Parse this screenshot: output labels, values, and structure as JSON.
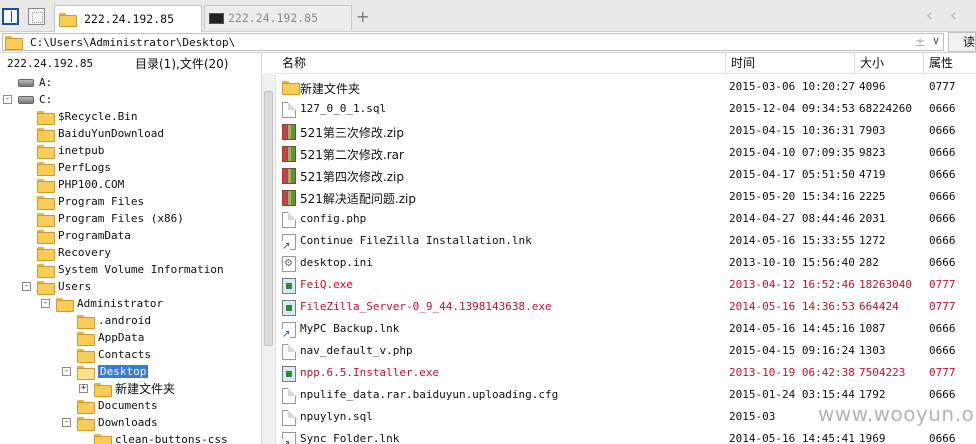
{
  "tabs": [
    {
      "label": "222.24.192.85",
      "active": true
    },
    {
      "label": "222.24.192.85",
      "active": false
    }
  ],
  "address": {
    "path": "C:\\Users\\Administrator\\Desktop\\",
    "read_label": "读"
  },
  "left": {
    "host": "222.24.192.85",
    "summary": "目录(1),文件(20)",
    "tree": [
      {
        "label": "A:",
        "depth": 0,
        "icon": "drive",
        "exp": ""
      },
      {
        "label": "C:",
        "depth": 0,
        "icon": "drive",
        "exp": "-"
      },
      {
        "label": "$Recycle.Bin",
        "depth": 1,
        "icon": "folder",
        "exp": ""
      },
      {
        "label": "BaiduYunDownload",
        "depth": 1,
        "icon": "folder",
        "exp": ""
      },
      {
        "label": "inetpub",
        "depth": 1,
        "icon": "folder",
        "exp": ""
      },
      {
        "label": "PerfLogs",
        "depth": 1,
        "icon": "folder",
        "exp": ""
      },
      {
        "label": "PHP100.COM",
        "depth": 1,
        "icon": "folder",
        "exp": ""
      },
      {
        "label": "Program Files",
        "depth": 1,
        "icon": "folder",
        "exp": ""
      },
      {
        "label": "Program Files (x86)",
        "depth": 1,
        "icon": "folder",
        "exp": ""
      },
      {
        "label": "ProgramData",
        "depth": 1,
        "icon": "folder",
        "exp": ""
      },
      {
        "label": "Recovery",
        "depth": 1,
        "icon": "folder",
        "exp": ""
      },
      {
        "label": "System Volume Information",
        "depth": 1,
        "icon": "folder",
        "exp": ""
      },
      {
        "label": "Users",
        "depth": 1,
        "icon": "folder",
        "exp": "-"
      },
      {
        "label": "Administrator",
        "depth": 2,
        "icon": "folder",
        "exp": "-"
      },
      {
        "label": ".android",
        "depth": 3,
        "icon": "folder",
        "exp": ""
      },
      {
        "label": "AppData",
        "depth": 3,
        "icon": "folder",
        "exp": ""
      },
      {
        "label": "Contacts",
        "depth": 3,
        "icon": "folder",
        "exp": ""
      },
      {
        "label": "Desktop",
        "depth": 3,
        "icon": "folder-open",
        "exp": "-",
        "selected": true
      },
      {
        "label": "新建文件夹",
        "depth": 4,
        "icon": "folder",
        "exp": "+"
      },
      {
        "label": "Documents",
        "depth": 3,
        "icon": "folder",
        "exp": ""
      },
      {
        "label": "Downloads",
        "depth": 3,
        "icon": "folder",
        "exp": "-"
      },
      {
        "label": "clean-buttons-css",
        "depth": 4,
        "icon": "folder",
        "exp": ""
      }
    ]
  },
  "columns": {
    "name": "名称",
    "time": "时间",
    "size": "大小",
    "attr": "属性"
  },
  "files": [
    {
      "name": "新建文件夹",
      "time": "2015-03-06 10:20:27",
      "size": "4096",
      "attr": "0777",
      "icon": "folder",
      "red": false
    },
    {
      "name": "127_0_0_1.sql",
      "time": "2015-12-04 09:34:53",
      "size": "68224260",
      "attr": "0666",
      "icon": "doc",
      "red": false
    },
    {
      "name": "521第三次修改.zip",
      "time": "2015-04-15 10:36:31",
      "size": "7903",
      "attr": "0666",
      "icon": "archive",
      "red": false
    },
    {
      "name": "521第二次修改.rar",
      "time": "2015-04-10 07:09:35",
      "size": "9823",
      "attr": "0666",
      "icon": "archive",
      "red": false
    },
    {
      "name": "521第四次修改.zip",
      "time": "2015-04-17 05:51:50",
      "size": "4719",
      "attr": "0666",
      "icon": "archive",
      "red": false
    },
    {
      "name": "521解决适配问题.zip",
      "time": "2015-05-20 15:34:16",
      "size": "2225",
      "attr": "0666",
      "icon": "archive",
      "red": false
    },
    {
      "name": "config.php",
      "time": "2014-04-27 08:44:46",
      "size": "2031",
      "attr": "0666",
      "icon": "doc",
      "red": false
    },
    {
      "name": "Continue FileZilla Installation.lnk",
      "time": "2014-05-16 15:33:55",
      "size": "1272",
      "attr": "0666",
      "icon": "lnk",
      "red": false
    },
    {
      "name": "desktop.ini",
      "time": "2013-10-10 15:56:40",
      "size": "282",
      "attr": "0666",
      "icon": "gear",
      "red": false
    },
    {
      "name": "FeiQ.exe",
      "time": "2013-04-12 16:52:46",
      "size": "18263040",
      "attr": "0777",
      "icon": "exe",
      "red": true
    },
    {
      "name": "FileZilla_Server-0_9_44.1398143638.exe",
      "time": "2014-05-16 14:36:53",
      "size": "664424",
      "attr": "0777",
      "icon": "exe",
      "red": true
    },
    {
      "name": "MyPC Backup.lnk",
      "time": "2014-05-16 14:45:16",
      "size": "1087",
      "attr": "0666",
      "icon": "lnk",
      "red": false
    },
    {
      "name": "nav_default_v.php",
      "time": "2015-04-15 09:16:24",
      "size": "1303",
      "attr": "0666",
      "icon": "doc",
      "red": false
    },
    {
      "name": "npp.6.5.Installer.exe",
      "time": "2013-10-19 06:42:38",
      "size": "7504223",
      "attr": "0777",
      "icon": "exe",
      "red": true
    },
    {
      "name": "npulife_data.rar.baiduyun.uploading.cfg",
      "time": "2015-01-24 03:15:44",
      "size": "1792",
      "attr": "0666",
      "icon": "doc",
      "red": false
    },
    {
      "name": "npuylyn.sql",
      "time": "2015-03",
      "size": "",
      "attr": "",
      "icon": "doc",
      "red": false
    },
    {
      "name": "Sync Folder.lnk",
      "time": "2014-05-16 14:45:41",
      "size": "1969",
      "attr": "0666",
      "icon": "lnk",
      "red": false
    }
  ],
  "watermark": "www.wooyun.org"
}
